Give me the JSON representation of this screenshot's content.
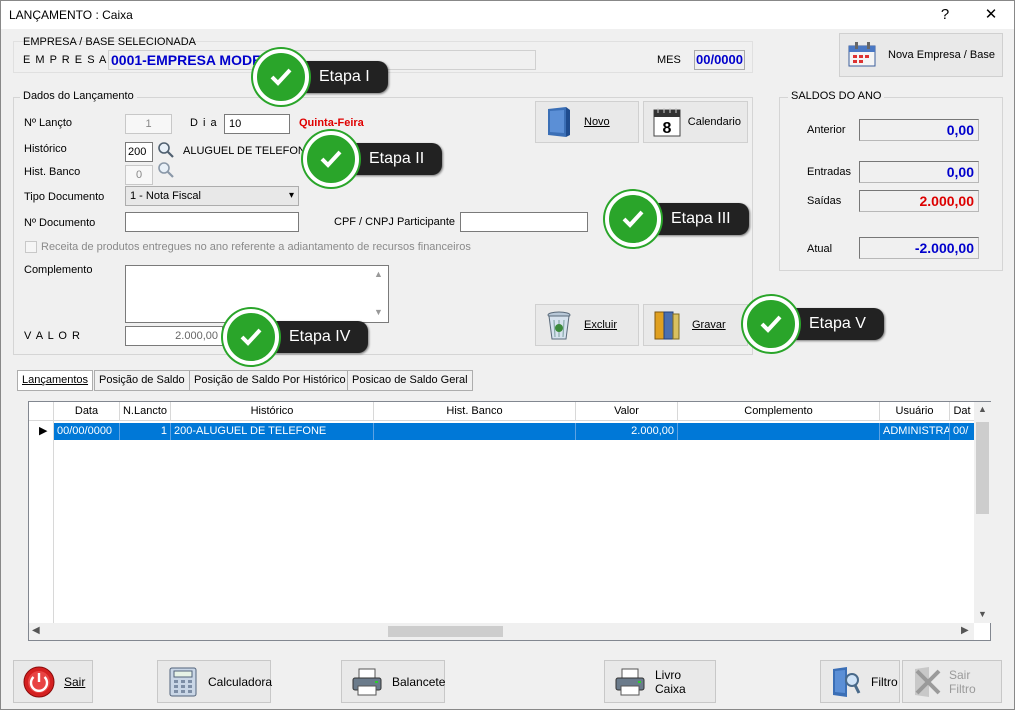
{
  "window": {
    "title": "LANÇAMENTO : Caixa",
    "help_label": "?",
    "close_label": "✕"
  },
  "empresa": {
    "section_label": "EMPRESA  /  BASE  SELECIONADA",
    "empresa_label": "E M P R E S A",
    "empresa_value": "0001-EMPRESA MODELO",
    "mes_label": "MES",
    "mes_value": "00/0000"
  },
  "nova_empresa_button": "Nova Empresa / Base",
  "dados": {
    "legend": "Dados do Lançamento",
    "nlancto_label": "Nº Lançto",
    "nlancto_value": "1",
    "dia_label": "D i a",
    "dia_value": "10",
    "weekday": "Quinta-Feira",
    "historico_label": "Histórico",
    "historico_code": "200",
    "historico_desc": "ALUGUEL DE TELEFONE",
    "hist_banco_label": "Hist. Banco",
    "hist_banco_value": "0",
    "tipo_doc_label": "Tipo Documento",
    "tipo_doc_value": "1 - Nota Fiscal",
    "ndoc_label": "Nº Documento",
    "ndoc_value": "",
    "cpf_label": "CPF / CNPJ Participante",
    "cpf_value": "",
    "receita_checkbox_label": "Receita de produtos entregues no ano referente a adiantamento de recursos financeiros",
    "complemento_label": "Complemento",
    "complemento_value": "",
    "valor_label": "V A L O R",
    "valor_value": "2.000,00"
  },
  "buttons": {
    "novo": "Novo",
    "calendario": "Calendario",
    "calendar_day": "8",
    "excluir": "Excluir",
    "gravar": "Gravar"
  },
  "saldos": {
    "legend": "SALDOS DO ANO",
    "anterior_label": "Anterior",
    "anterior_value": "0,00",
    "entradas_label": "Entradas",
    "entradas_value": "0,00",
    "saidas_label": "Saídas",
    "saidas_value": "2.000,00",
    "atual_label": "Atual",
    "atual_value": "-2.000,00"
  },
  "tabs": [
    {
      "label": "Lançamentos"
    },
    {
      "label": "Posição de Saldo"
    },
    {
      "label": "Posição de Saldo Por Histórico"
    },
    {
      "label": "Posicao de Saldo Geral"
    }
  ],
  "grid": {
    "columns": [
      "Data",
      "N.Lancto",
      "Histórico",
      "Hist. Banco",
      "Valor",
      "Complemento",
      "Usuário",
      "Dat"
    ],
    "rows": [
      {
        "data": "00/00/0000",
        "nlancto": "1",
        "historico": "200-ALUGUEL DE TELEFONE",
        "hist_banco": "",
        "valor": "2.000,00",
        "complemento": "",
        "usuario": "ADMINISTRA",
        "dat": "00/"
      }
    ]
  },
  "footer": {
    "sair": "Sair",
    "calculadora": "Calculadora",
    "balancete": "Balancete",
    "livro_caixa": "Livro Caixa",
    "filtro": "Filtro",
    "sair_filtro": "Sair Filtro"
  },
  "etapas": {
    "etapa1": "Etapa I",
    "etapa2": "Etapa II",
    "etapa3": "Etapa III",
    "etapa4": "Etapa IV",
    "etapa5": "Etapa V"
  },
  "colors": {
    "accent_blue": "#0000cc",
    "weekday_red": "#e00000",
    "negative_red": "#dd0000",
    "selection": "#0078d7",
    "badge_green": "#2aa52a"
  }
}
